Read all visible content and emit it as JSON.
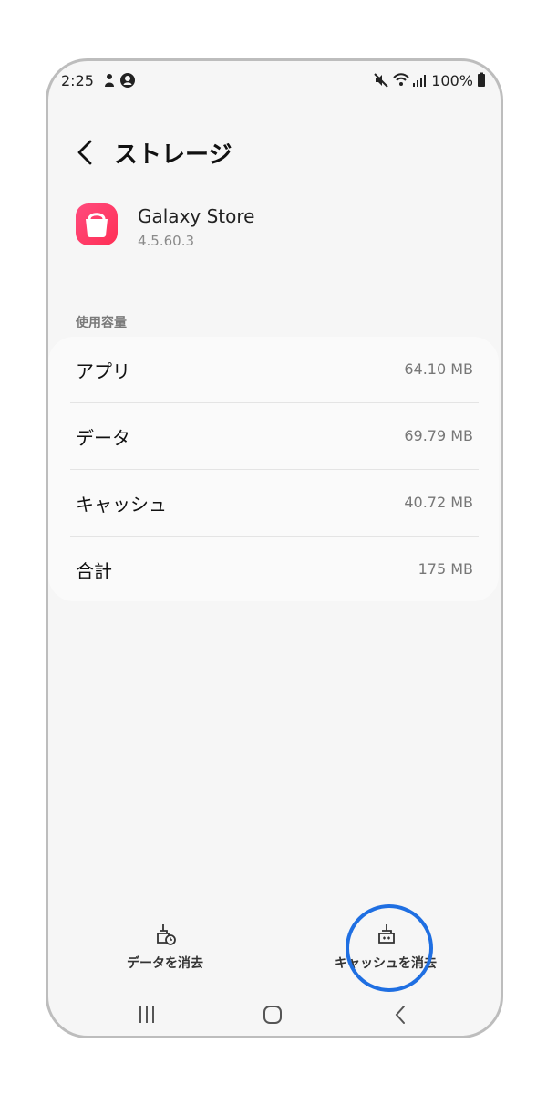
{
  "status_bar": {
    "time": "2:25",
    "battery": "100%",
    "icons": [
      "person-icon",
      "account-circle-icon",
      "mute-icon",
      "wifi-icon",
      "signal-icon",
      "battery-icon"
    ]
  },
  "header": {
    "title": "ストレージ",
    "back_icon": "chevron-left-icon"
  },
  "app": {
    "name": "Galaxy Store",
    "version": "4.5.60.3",
    "icon": "shopping-bag-icon",
    "icon_color": "#ff3b63"
  },
  "usage": {
    "section_title": "使用容量",
    "rows": [
      {
        "label": "アプリ",
        "value": "64.10 MB"
      },
      {
        "label": "データ",
        "value": "69.79 MB"
      },
      {
        "label": "キャッシュ",
        "value": "40.72 MB"
      },
      {
        "label": "合計",
        "value": "175 MB"
      }
    ]
  },
  "actions": {
    "clear_data": "データを消去",
    "clear_cache": "キャッシュを消去"
  },
  "highlight_color": "#1f6fe2"
}
